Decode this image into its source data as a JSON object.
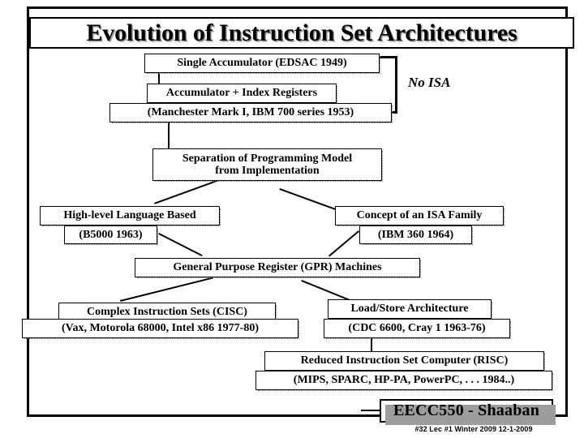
{
  "slide": {
    "title": "Evolution of Instruction Set Architectures",
    "annotation": "No ISA"
  },
  "boxes": {
    "single_accumulator": "Single Accumulator (EDSAC 1949)",
    "accumulator_index": "Accumulator + Index Registers",
    "manchester": "(Manchester Mark I, IBM 700 series 1953)",
    "separation_line1": "Separation of Programming Model",
    "separation_line2": "from Implementation",
    "hll_based": "High-level Language Based",
    "b5000": "(B5000 1963)",
    "isa_family": "Concept of an ISA Family",
    "ibm360": "(IBM 360 1964)",
    "gpr": "General Purpose Register (GPR) Machines",
    "cisc": "Complex Instruction Sets (CISC)",
    "cisc_examples": "(Vax, Motorola 68000, Intel x86 1977-80)",
    "load_store": "Load/Store Architecture",
    "load_store_examples": "(CDC 6600, Cray 1 1963-76)",
    "risc": "Reduced Instruction Set Computer (RISC)",
    "risc_examples": "(MIPS, SPARC, HP-PA, PowerPC, . . . 1984..)"
  },
  "footer": {
    "course": "EECC550 - Shaaban",
    "meta": "#32   Lec #1  Winter 2009  12-1-2009"
  }
}
